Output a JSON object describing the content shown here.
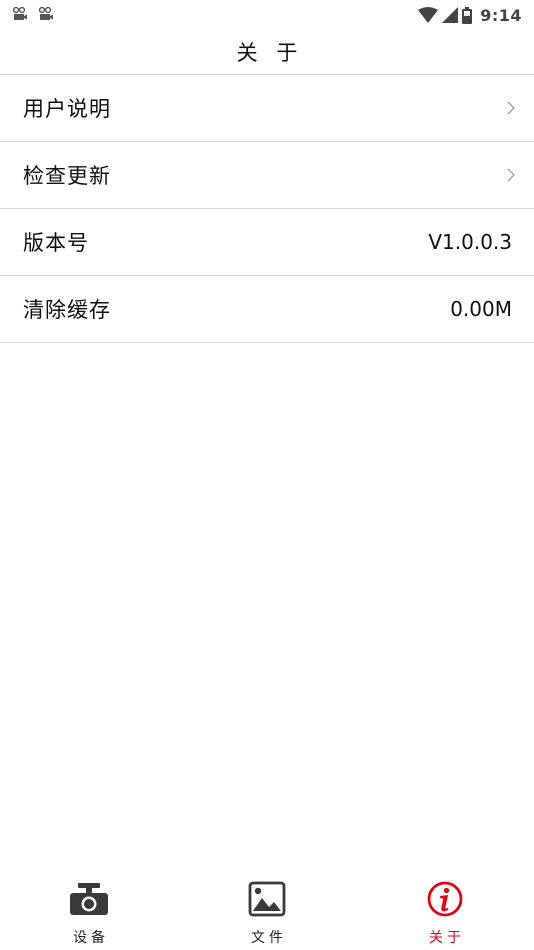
{
  "status_bar": {
    "time": "9:14",
    "left_icons": [
      "notification-icon",
      "notification-icon"
    ],
    "right_icons": [
      "wifi-icon",
      "signal-icon",
      "battery-icon"
    ]
  },
  "header": {
    "title": "关 于"
  },
  "settings": [
    {
      "label": "用户说明",
      "value": "",
      "has_chevron": true
    },
    {
      "label": "检查更新",
      "value": "",
      "has_chevron": true
    },
    {
      "label": "版本号",
      "value": "V1.0.0.3",
      "has_chevron": false
    },
    {
      "label": "清除缓存",
      "value": "0.00M",
      "has_chevron": false
    }
  ],
  "tabs": [
    {
      "label": "设备",
      "icon": "camera-icon",
      "active": false
    },
    {
      "label": "文件",
      "icon": "image-icon",
      "active": false
    },
    {
      "label": "关于",
      "icon": "info-icon",
      "active": true
    }
  ],
  "colors": {
    "accent": "#e60012",
    "icon_dark": "#3a3a3a",
    "divider": "#d6d6d6"
  }
}
